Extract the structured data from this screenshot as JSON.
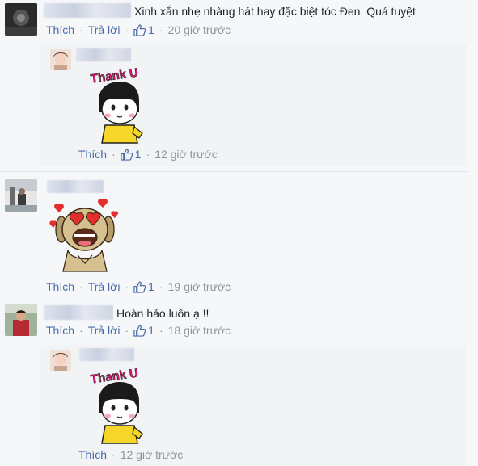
{
  "comments": [
    {
      "text": "Xinh xắn nhẹ nhàng hát hay đặc biệt tóc Đen. Quá tuyệt",
      "like_label": "Thích",
      "reply_label": "Trả lời",
      "like_count": "1",
      "time": "20 giờ trước",
      "reply": {
        "sticker_text": "Thank U",
        "like_label": "Thích",
        "like_count": "1",
        "time": "12 giờ trước"
      }
    },
    {
      "sticker": "heart-eyes-dog-sticker",
      "like_label": "Thích",
      "reply_label": "Trả lời",
      "like_count": "1",
      "time": "19 giờ trước"
    },
    {
      "text": "Hoàn hảo luôn ạ !!",
      "like_label": "Thích",
      "reply_label": "Trả lời",
      "like_count": "1",
      "time": "18 giờ trước",
      "reply": {
        "sticker_text": "Thank U",
        "like_label": "Thích",
        "time": "12 giờ trước"
      }
    }
  ],
  "separator": "·",
  "colors": {
    "link": "#4b6aa8",
    "meta": "#90949c",
    "sticker_pink": "#e6197f",
    "sticker_yellow": "#f5d629"
  }
}
